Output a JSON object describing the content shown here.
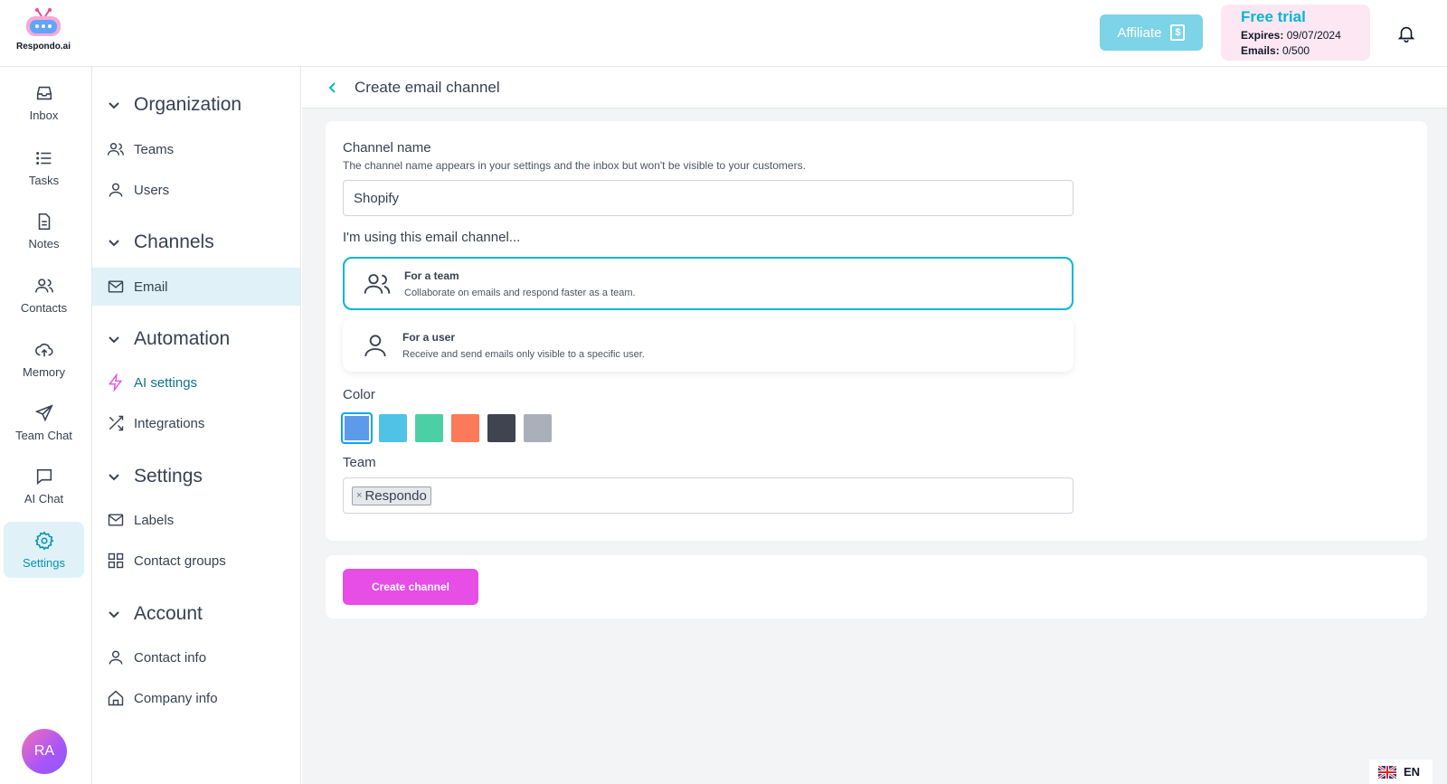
{
  "brand": {
    "name": "Respondo.ai"
  },
  "topbar": {
    "affiliate_label": "Affiliate",
    "trial": {
      "title": "Free trial",
      "expires_label": "Expires:",
      "expires_value": "09/07/2024",
      "emails_label": "Emails:",
      "emails_value": "0/500"
    }
  },
  "rail": {
    "items": [
      {
        "label": "Inbox",
        "icon": "inbox-icon"
      },
      {
        "label": "Tasks",
        "icon": "list-icon"
      },
      {
        "label": "Notes",
        "icon": "document-icon"
      },
      {
        "label": "Contacts",
        "icon": "users-icon"
      },
      {
        "label": "Memory",
        "icon": "cloud-upload-icon"
      },
      {
        "label": "Team Chat",
        "icon": "send-icon"
      },
      {
        "label": "AI Chat",
        "icon": "chat-icon"
      },
      {
        "label": "Settings",
        "icon": "gear-icon",
        "active": true
      }
    ],
    "avatar_initials": "RA"
  },
  "sidebar": {
    "sections": [
      {
        "title": "Organization",
        "items": [
          "Teams",
          "Users"
        ]
      },
      {
        "title": "Channels",
        "items": [
          "Email"
        ]
      },
      {
        "title": "Automation",
        "items": [
          "AI settings",
          "Integrations"
        ]
      },
      {
        "title": "Settings",
        "items": [
          "Labels",
          "Contact groups"
        ]
      },
      {
        "title": "Account",
        "items": [
          "Contact info",
          "Company info"
        ]
      }
    ]
  },
  "main": {
    "title": "Create email channel",
    "channel_name_label": "Channel name",
    "channel_name_help": "The channel name appears in your settings and the inbox but won't be visible to your customers.",
    "channel_name_value": "Shopify",
    "usage_label": "I'm using this email channel...",
    "options": [
      {
        "title": "For a team",
        "desc": "Collaborate on emails and respond faster as a team.",
        "selected": true
      },
      {
        "title": "For a user",
        "desc": "Receive and send emails only visible to a specific user.",
        "selected": false
      }
    ],
    "color_label": "Color",
    "colors": [
      "#5b9bea",
      "#4fc3e6",
      "#4dcfa6",
      "#fa7a59",
      "#3f4450",
      "#aab0ba"
    ],
    "selected_color": "#5b9bea",
    "team_label": "Team",
    "team_tags": [
      "Respondo"
    ],
    "create_button": "Create channel"
  },
  "language": {
    "code": "EN"
  }
}
